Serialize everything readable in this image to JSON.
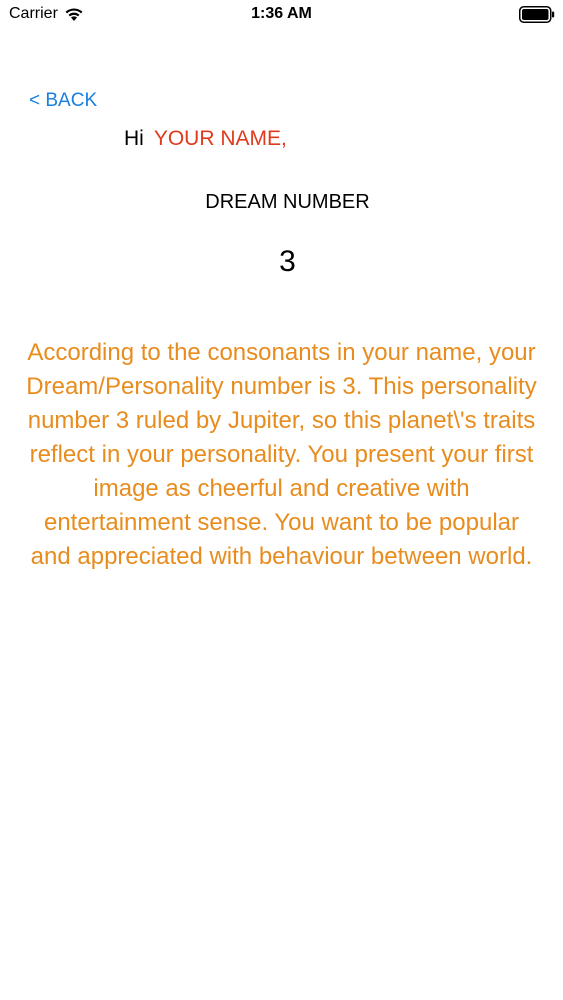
{
  "status_bar": {
    "carrier": "Carrier",
    "time": "1:36 AM",
    "wifi_icon": "wifi-icon",
    "battery_icon": "battery-full-icon"
  },
  "nav": {
    "back_label": "< BACK"
  },
  "greeting": {
    "hi": "Hi",
    "name": "YOUR NAME,"
  },
  "dream": {
    "label": "DREAM NUMBER",
    "value": "3"
  },
  "description": "According to the consonants in your name, your Dream/Personality number is 3. This personality number 3 ruled by Jupiter, so this planet\\'s traits reflect in your personality. You present your first image as cheerful and creative with entertainment sense. You want to be popular and appreciated with behaviour between world.",
  "colors": {
    "back_link": "#1a7fe0",
    "name": "#e03a1e",
    "description": "#e88c1e"
  }
}
